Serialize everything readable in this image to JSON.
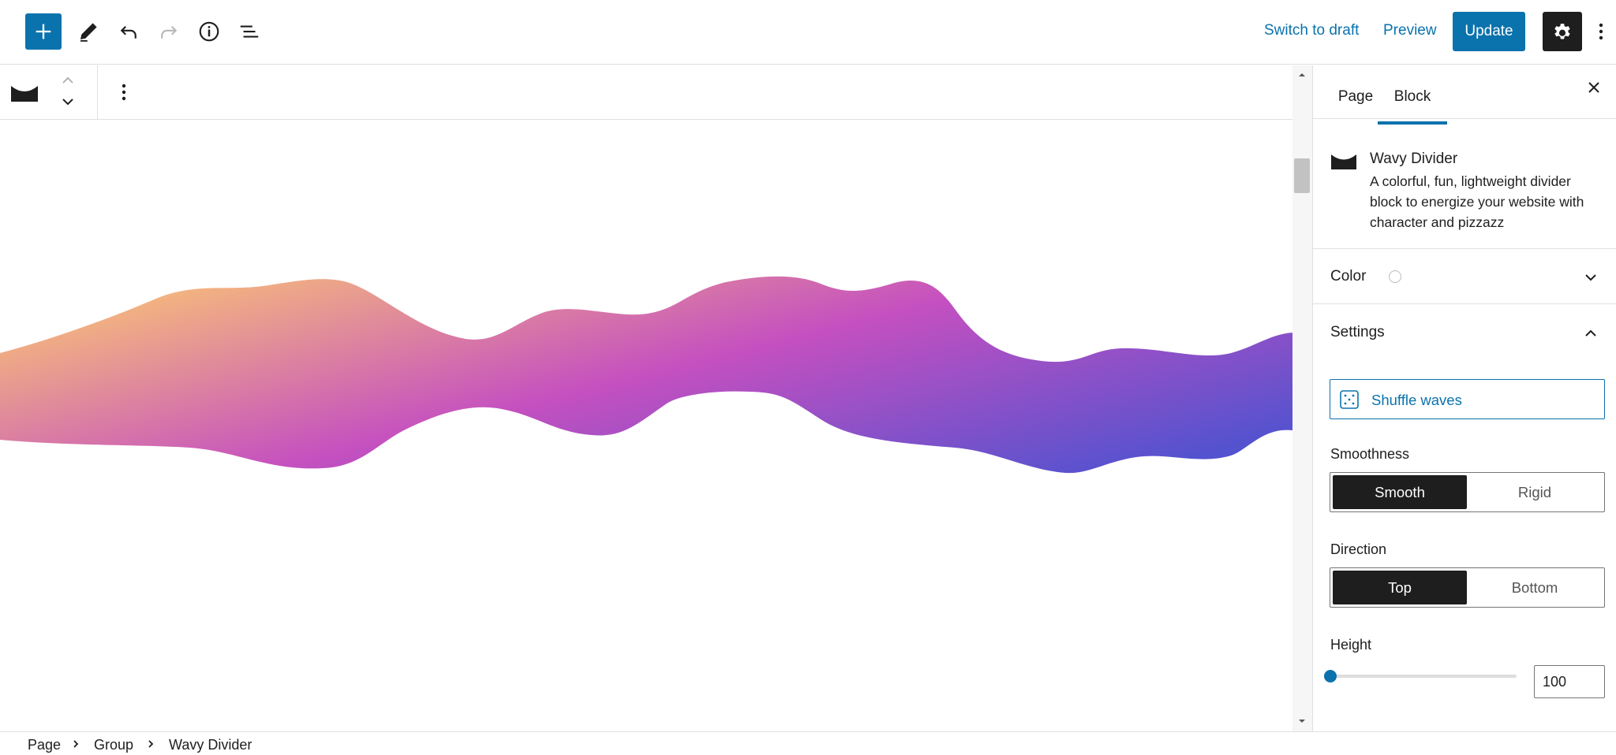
{
  "header": {
    "switch_to_draft": "Switch to draft",
    "preview": "Preview",
    "update": "Update"
  },
  "sidebar": {
    "tabs": [
      {
        "label": "Page",
        "active": false
      },
      {
        "label": "Block",
        "active": true
      }
    ],
    "block_card": {
      "title": "Wavy Divider",
      "description": "A colorful, fun, lightweight divider block to energize your website with character and pizzazz"
    },
    "color_panel": {
      "title": "Color",
      "expanded": false
    },
    "settings_panel": {
      "title": "Settings",
      "expanded": true,
      "shuffle_label": "Shuffle waves",
      "smoothness": {
        "label": "Smoothness",
        "options": [
          "Smooth",
          "Rigid"
        ],
        "selected": "Smooth"
      },
      "direction": {
        "label": "Direction",
        "options": [
          "Top",
          "Bottom"
        ],
        "selected": "Top"
      },
      "height": {
        "label": "Height",
        "value": "100",
        "fraction": 0.0
      }
    }
  },
  "breadcrumb": [
    "Page",
    "Group",
    "Wavy Divider"
  ],
  "colors": {
    "accent": "#0a72ad",
    "dark": "#1e1e1e",
    "wave_start": "#f7bd7a",
    "wave_mid": "#c550c0",
    "wave_end": "#5352cf"
  },
  "icons": {
    "inserter": "plus-icon",
    "tools": "pencil-icon",
    "undo": "undo-icon",
    "redo": "redo-icon",
    "info": "info-icon",
    "list_view": "list-view-icon",
    "settings": "gear-icon",
    "more": "vertical-ellipsis-icon",
    "close": "close-icon",
    "shuffle": "dice-icon"
  }
}
